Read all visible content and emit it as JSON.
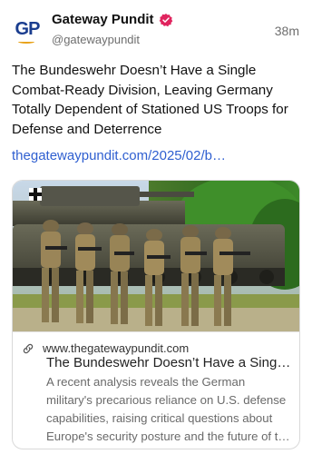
{
  "post": {
    "author": {
      "avatar_text": "GP",
      "name": "Gateway Pundit",
      "handle": "@gatewaypundit",
      "verified_icon": "verified-badge-icon",
      "verified_color": "#e0245e"
    },
    "time": "38m",
    "text": "The Bundeswehr Doesn’t Have a Single Combat-Ready Division, Leaving Germany Totally Dependent of Stationed US Troops for Defense and Deterrence",
    "link": "thegatewaypundit.com/2025/02/b…"
  },
  "card": {
    "image_icon": "soldiers-with-tank-image",
    "link_icon": "link-icon",
    "domain": "www.thegatewaypundit.com",
    "title": "The Bundeswehr Doesn’t Have a Singl…",
    "description": "A recent analysis reveals the German military's precarious reliance on U.S. defense capabilities, raising critical questions about Europe's security posture and the future of t…"
  },
  "colors": {
    "link": "#2f5fd0",
    "brand_blue": "#1a3d8f",
    "brand_orange": "#e8a21a"
  }
}
